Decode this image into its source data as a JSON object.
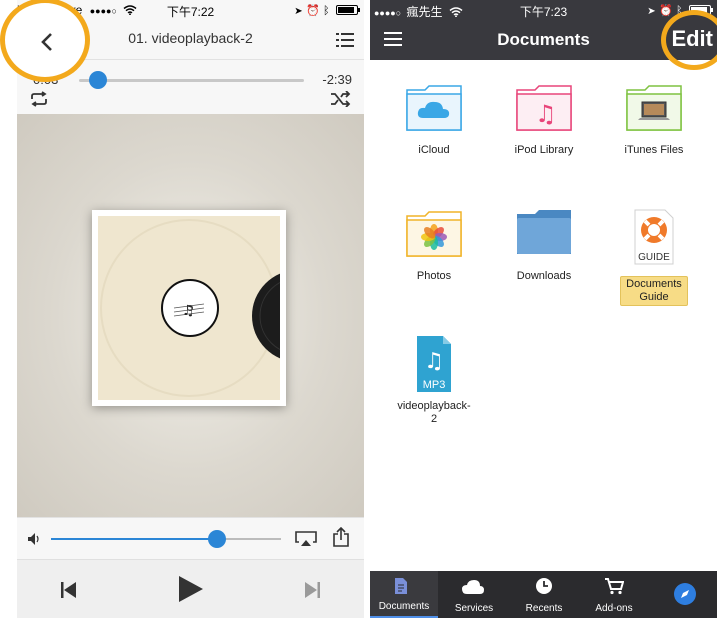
{
  "left": {
    "status": {
      "carrier": "iCloud Drive",
      "signal": "●●●●○",
      "time": "下午7:22"
    },
    "nav": {
      "title": "01. videoplayback-2"
    },
    "progress": {
      "elapsed": "0:03",
      "remaining": "-2:39",
      "position_fraction": 0.05
    },
    "volume": {
      "level_fraction": 0.72
    },
    "icons": {
      "back": "chevron-left-icon",
      "queue": "list-icon",
      "repeat": "repeat-icon",
      "shuffle": "shuffle-icon",
      "volume": "speaker-icon",
      "airplay": "airplay-icon",
      "share": "share-icon",
      "previous": "skip-back-icon",
      "play": "play-icon",
      "next": "skip-forward-icon"
    }
  },
  "right": {
    "status": {
      "signal": "●●●●○",
      "carrier": "瘋先生",
      "time": "下午7:23"
    },
    "header": {
      "title": "Documents",
      "edit_label": "Edit"
    },
    "items": [
      {
        "label": "iCloud",
        "icon": "icloud-folder-icon",
        "color": "#3aa7e6",
        "highlighted": false
      },
      {
        "label": "iPod Library",
        "icon": "music-folder-icon",
        "color": "#e8457a",
        "highlighted": false
      },
      {
        "label": "iTunes Files",
        "icon": "laptop-folder-icon",
        "color": "#7fc241",
        "highlighted": false
      },
      {
        "label": "Photos",
        "icon": "photos-folder-icon",
        "color": "#f0b429",
        "highlighted": false
      },
      {
        "label": "Downloads",
        "icon": "downloads-folder-icon",
        "color": "#5d9bd4",
        "highlighted": false
      },
      {
        "label": "Documents Guide",
        "icon": "guide-lifebuoy-icon",
        "color": "#f07a2a",
        "highlighted": true,
        "badge": "GUIDE"
      },
      {
        "label": "videoplayback-2",
        "icon": "mp3-file-icon",
        "color": "#2fa3d1",
        "highlighted": false,
        "badge": "MP3"
      }
    ],
    "tabs": [
      {
        "label": "Documents",
        "icon": "document-icon",
        "active": true
      },
      {
        "label": "Services",
        "icon": "cloud-icon",
        "active": false
      },
      {
        "label": "Recents",
        "icon": "clock-icon",
        "active": false
      },
      {
        "label": "Add-ons",
        "icon": "cart-icon",
        "active": false
      },
      {
        "label": "",
        "icon": "compass-icon",
        "active": false
      }
    ]
  },
  "colors": {
    "accent_blue": "#2b86d6",
    "highlight_ring": "#f3a91c",
    "header_dark": "#39393e"
  }
}
